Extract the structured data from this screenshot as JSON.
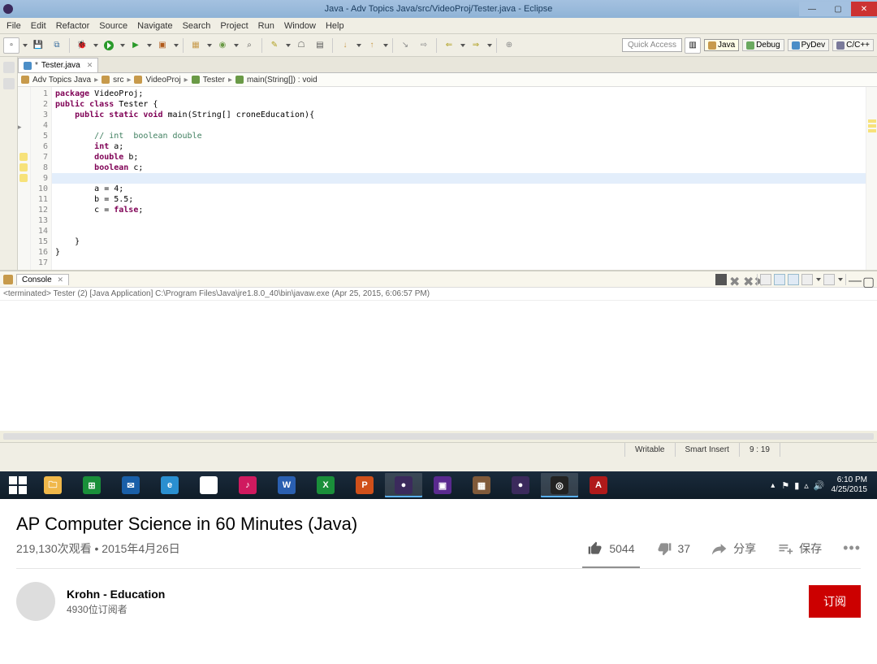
{
  "eclipse": {
    "titlebar": "Java - Adv Topics Java/src/VideoProj/Tester.java - Eclipse",
    "menus": [
      "File",
      "Edit",
      "Refactor",
      "Source",
      "Navigate",
      "Search",
      "Project",
      "Run",
      "Window",
      "Help"
    ],
    "quick_access": "Quick Access",
    "perspectives": [
      {
        "label": "Java",
        "active": true,
        "color": "#c79a4b"
      },
      {
        "label": "Debug",
        "active": false,
        "color": "#6aa95f"
      },
      {
        "label": "PyDev",
        "active": false,
        "color": "#4b8ec7"
      },
      {
        "label": "C/C++",
        "active": false,
        "color": "#7a7a9a"
      }
    ],
    "editor_tab": {
      "label": "Tester.java",
      "dirty": true
    },
    "breadcrumb": [
      {
        "label": "Adv Topics Java",
        "color": "#c79a4b"
      },
      {
        "label": "src",
        "color": "#c79a4b"
      },
      {
        "label": "VideoProj",
        "color": "#c79a4b"
      },
      {
        "label": "Tester",
        "color": "#6a9a46"
      },
      {
        "label": "main(String[]) : void",
        "color": "#6a9a46"
      }
    ],
    "code_lines": [
      {
        "n": 1,
        "seg": [
          {
            "t": "package ",
            "c": "kw"
          },
          {
            "t": "VideoProj;"
          }
        ]
      },
      {
        "n": 2,
        "seg": [
          {
            "t": ""
          }
        ]
      },
      {
        "n": 3,
        "seg": [
          {
            "t": "public class ",
            "c": "kw"
          },
          {
            "t": "Tester {"
          }
        ]
      },
      {
        "n": 4,
        "seg": [
          {
            "t": "    "
          },
          {
            "t": "public static void ",
            "c": "kw"
          },
          {
            "t": "main(String[] croneEducation){"
          }
        ],
        "marker": "arrow"
      },
      {
        "n": 5,
        "seg": [
          {
            "t": "        "
          }
        ]
      },
      {
        "n": 6,
        "seg": [
          {
            "t": "        "
          },
          {
            "t": "// int  boolean double",
            "c": "cmt"
          }
        ]
      },
      {
        "n": 7,
        "seg": [
          {
            "t": "        "
          },
          {
            "t": "int ",
            "c": "kw"
          },
          {
            "t": "a;"
          }
        ],
        "marker": "warn"
      },
      {
        "n": 8,
        "seg": [
          {
            "t": "        "
          },
          {
            "t": "double ",
            "c": "kw"
          },
          {
            "t": "b;"
          }
        ],
        "marker": "warn"
      },
      {
        "n": 9,
        "seg": [
          {
            "t": "        "
          },
          {
            "t": "boolean ",
            "c": "kw"
          },
          {
            "t": "c;"
          }
        ],
        "hl": true,
        "marker": "warn"
      },
      {
        "n": 10,
        "seg": [
          {
            "t": "        "
          }
        ]
      },
      {
        "n": 11,
        "seg": [
          {
            "t": "        a = 4;"
          }
        ]
      },
      {
        "n": 12,
        "seg": [
          {
            "t": "        b = 5.5;"
          }
        ]
      },
      {
        "n": 13,
        "seg": [
          {
            "t": "        c = "
          },
          {
            "t": "false",
            "c": "kw"
          },
          {
            "t": ";"
          }
        ]
      },
      {
        "n": 14,
        "seg": [
          {
            "t": "        "
          }
        ]
      },
      {
        "n": 15,
        "seg": [
          {
            "t": "        "
          }
        ]
      },
      {
        "n": 16,
        "seg": [
          {
            "t": "    }"
          }
        ]
      },
      {
        "n": 17,
        "seg": [
          {
            "t": "}"
          }
        ]
      }
    ],
    "console_tab": "Console",
    "console_header": "<terminated> Tester (2) [Java Application] C:\\Program Files\\Java\\jre1.8.0_40\\bin\\javaw.exe (Apr 25, 2015, 6:06:57 PM)",
    "status": {
      "writable": "Writable",
      "insert": "Smart Insert",
      "pos": "9 : 19"
    }
  },
  "taskbar": {
    "apps": [
      {
        "name": "file-explorer",
        "color": "#f0b84a",
        "glyph": "🗀"
      },
      {
        "name": "store",
        "color": "#1a8f3a",
        "glyph": "⊞"
      },
      {
        "name": "mail",
        "color": "#1a5fa8",
        "glyph": "✉"
      },
      {
        "name": "ie",
        "color": "#2a8fd0",
        "glyph": "e"
      },
      {
        "name": "chrome",
        "color": "#fff",
        "glyph": "◉"
      },
      {
        "name": "itunes",
        "color": "#d01a5f",
        "glyph": "♪"
      },
      {
        "name": "word",
        "color": "#2a5fb0",
        "glyph": "W"
      },
      {
        "name": "excel",
        "color": "#1a8f3a",
        "glyph": "X"
      },
      {
        "name": "powerpoint",
        "color": "#d0501a",
        "glyph": "P"
      },
      {
        "name": "eclipse",
        "color": "#3b2a5c",
        "glyph": "●",
        "active": true
      },
      {
        "name": "visual-studio",
        "color": "#5a2a8f",
        "glyph": "▣"
      },
      {
        "name": "app1",
        "color": "#805a3a",
        "glyph": "▦"
      },
      {
        "name": "eclipse2",
        "color": "#3b2a5c",
        "glyph": "●"
      },
      {
        "name": "obs",
        "color": "#222",
        "glyph": "◎",
        "active": true
      },
      {
        "name": "acrobat",
        "color": "#b01a1a",
        "glyph": "A"
      }
    ],
    "clock": {
      "time": "6:10 PM",
      "date": "4/25/2015"
    }
  },
  "youtube": {
    "title": "AP Computer Science in 60 Minutes (Java)",
    "views_line": "219,130次观看 • 2015年4月26日",
    "likes": "5044",
    "dislikes": "37",
    "share": "分享",
    "save": "保存",
    "channel_name": "Krohn - Education",
    "subscribers": "4930位订阅者",
    "subscribe": "订阅"
  }
}
